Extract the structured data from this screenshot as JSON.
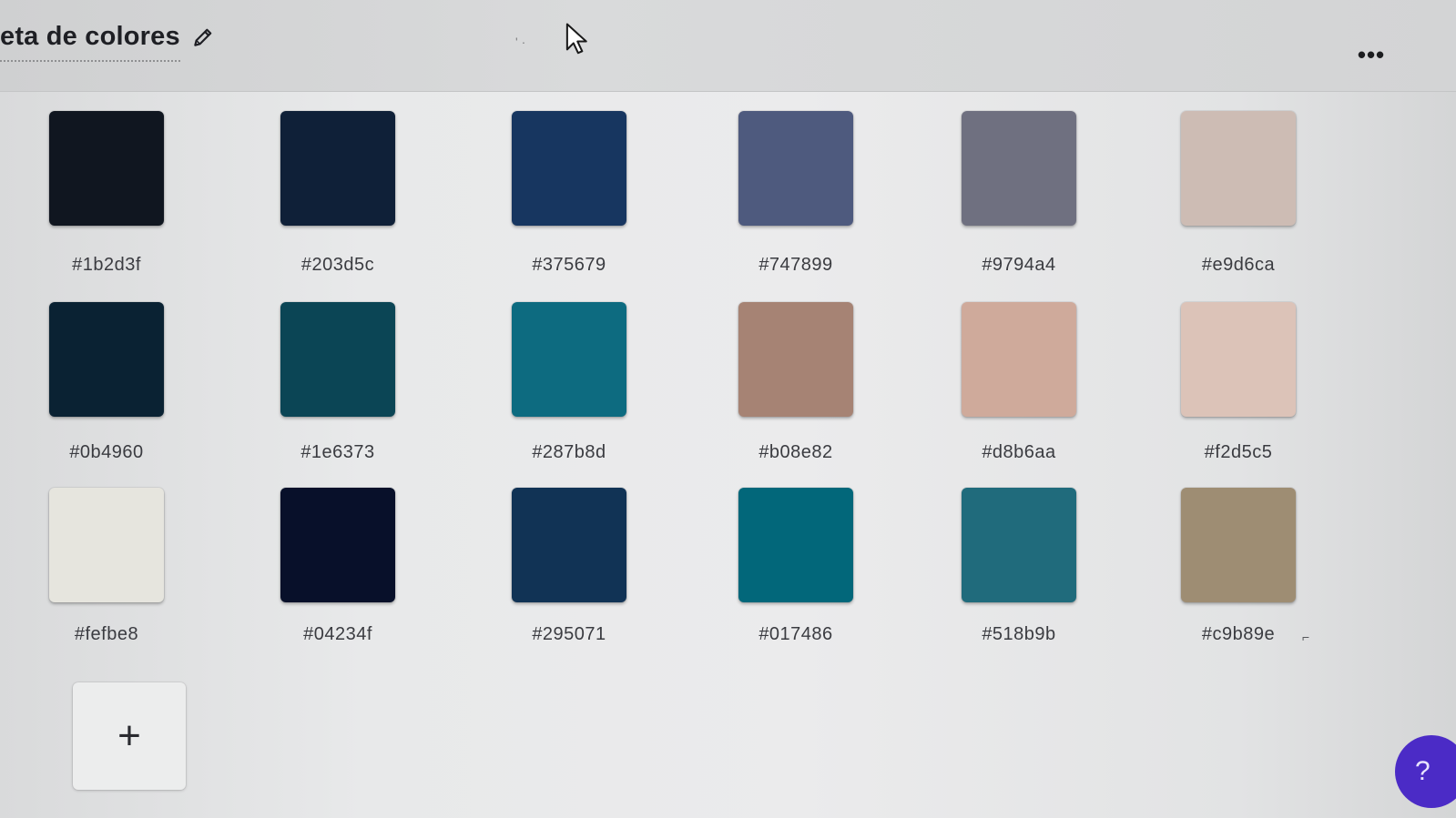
{
  "header": {
    "title": "eta de colores",
    "edit_icon": "pencil-icon",
    "tiny_mark": "' ·",
    "more_label": "•••"
  },
  "palette": {
    "colors": [
      {
        "hex": "#1b2d3f",
        "display": "#101620"
      },
      {
        "hex": "#203d5c",
        "display": "#0f2038"
      },
      {
        "hex": "#375679",
        "display": "#173660"
      },
      {
        "hex": "#747899",
        "display": "#4e5a7e"
      },
      {
        "hex": "#9794a4",
        "display": "#6f7080"
      },
      {
        "hex": "#e9d6ca",
        "display": "#cdbcb4"
      },
      {
        "hex": "#0b4960",
        "display": "#0a2233"
      },
      {
        "hex": "#1e6373",
        "display": "#0b4555"
      },
      {
        "hex": "#287b8d",
        "display": "#0d6b80"
      },
      {
        "hex": "#b08e82",
        "display": "#a68374"
      },
      {
        "hex": "#d8b6aa",
        "display": "#cfaa9b"
      },
      {
        "hex": "#f2d5c5",
        "display": "#dcc3b8"
      },
      {
        "hex": "#fefbe8",
        "display": "#e6e5de"
      },
      {
        "hex": "#04234f",
        "display": "#08102a"
      },
      {
        "hex": "#295071",
        "display": "#113355"
      },
      {
        "hex": "#017486",
        "display": "#02677a"
      },
      {
        "hex": "#518b9b",
        "display": "#206b7c"
      },
      {
        "hex": "#c9b89e",
        "display": "#9e8d73"
      }
    ]
  },
  "add_button": {
    "label": "+"
  },
  "help_button": {
    "label": "?"
  },
  "stray_mark": "⌐"
}
